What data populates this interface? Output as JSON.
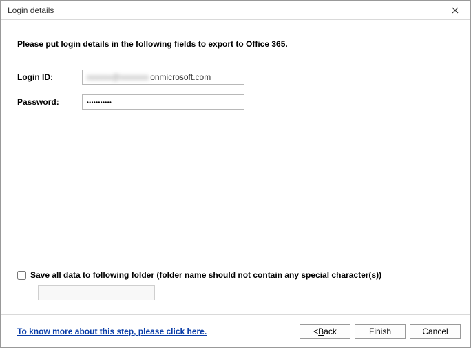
{
  "window": {
    "title": "Login details"
  },
  "body": {
    "instruction": "Please put login details in the following fields to export to Office 365.",
    "login_label": "Login ID:",
    "login_value_blurred": "xxxxxx@xxxxxxx",
    "login_value_clear": "onmicrosoft.com",
    "password_label": "Password:",
    "password_value": "●●●●●●●●●●●",
    "save_checkbox_label": "Save all data to following folder (folder name should not contain any special character(s))",
    "save_folder_value": "",
    "save_checked": false
  },
  "footer": {
    "link_text": "To know more about this step, please click here.",
    "back_prefix": "< ",
    "back_u": "B",
    "back_rest": "ack",
    "finish": "Finish",
    "cancel": "Cancel"
  }
}
